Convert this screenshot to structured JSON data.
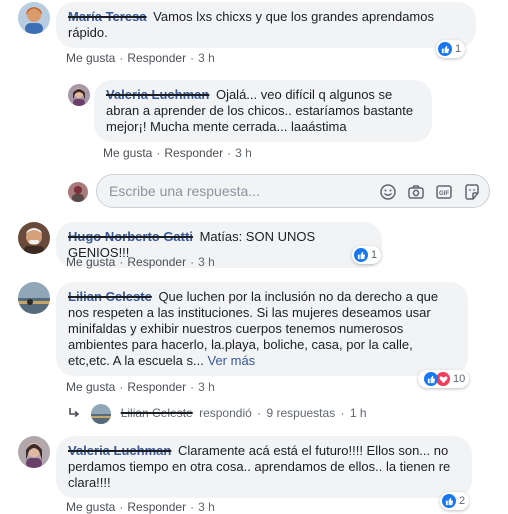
{
  "labels": {
    "like": "Me gusta",
    "reply": "Responder",
    "sep": "·"
  },
  "comments": [
    {
      "author": "María Teresa",
      "text": "Vamos lxs chicxs y que los grandes aprendamos rápido.",
      "time": "3 h",
      "reactions": "1"
    },
    {
      "author": "Valeria Luchman",
      "text": "Ojalá... veo difícil q algunos se abran a aprender de los chicos.. estaríamos bastante mejor¡! Mucha mente cerrada... laaástima",
      "time": "3 h"
    },
    {
      "author": "Hugo Norberto Gatti",
      "text": "Matías: SON UNOS GENIOS!!!",
      "time": "3 h",
      "reactions": "1"
    },
    {
      "author": "Lilian Celeste",
      "text": "Que luchen por la inclusión no da derecho a que nos respeten a las instituciones. Si las mujeres deseamos usar minifaldas y exhibir nuestros cuerpos tenemos numerosos ambientes para hacerlo, la.playa, boliche, casa, por la calle, etc,etc. A la escuela s...",
      "more": "Ver más",
      "time": "3 h",
      "reactions": "10"
    },
    {
      "author": "Valeria Luchman",
      "text": "Claramente acá está el futuro!!!! Ellos son... no perdamos tiempo en otra cosa.. aprendamos de ellos.. la tienen re clara!!!!",
      "time": "3 h",
      "reactions": "2"
    }
  ],
  "reply_box": {
    "placeholder": "Escribe una respuesta..."
  },
  "replies_summary": {
    "author": "Lilian Celeste",
    "verb": "respondió",
    "count": "9 respuestas",
    "time": "1 h"
  },
  "colors": {
    "like": "#1877f2",
    "love": "#f33e58",
    "link": "#385898"
  },
  "icons": [
    "emoji-icon",
    "camera-icon",
    "gif-icon",
    "sticker-icon",
    "like-icon",
    "love-icon",
    "reply-arrow-icon"
  ]
}
